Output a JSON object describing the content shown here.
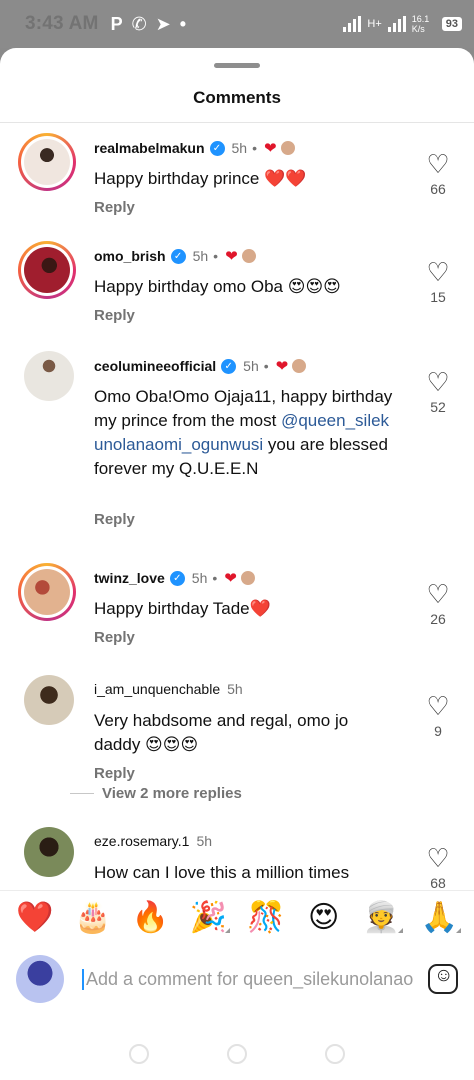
{
  "status_bar": {
    "time": "3:43 AM",
    "network_type": "H+",
    "speed": "16.1 K/s",
    "battery": "93"
  },
  "sheet": {
    "title": "Comments"
  },
  "comments": [
    {
      "username": "realmabelmakun",
      "verified": true,
      "time": "5h",
      "text": "Happy birthday prince ❤️❤️",
      "reply_label": "Reply",
      "likes": "66",
      "story_ring": true,
      "avatar_color": "#c9a58f"
    },
    {
      "username": "omo_brish",
      "verified": true,
      "time": "5h",
      "text": "Happy birthday omo Oba 😍😍😍",
      "reply_label": "Reply",
      "likes": "15",
      "story_ring": true,
      "avatar_color": "#a01e2e"
    },
    {
      "username": "ceolumineeofficial",
      "verified": true,
      "time": "5h",
      "text_before": "Omo Oba!Omo Ojaja11,  happy birthday my prince from the most ",
      "mention": "@queen_silekunolanaomi_ogunwusi",
      "text_after": "  you are blessed forever my Q.U.E.E.N",
      "reply_label": "Reply",
      "likes": "52",
      "story_ring": false,
      "avatar_color": "#d9d6cf"
    },
    {
      "username": "twinz_love",
      "verified": true,
      "time": "5h",
      "text": "Happy birthday Tade❤️",
      "reply_label": "Reply",
      "likes": "26",
      "story_ring": true,
      "avatar_color": "#e2b28f"
    },
    {
      "username": "i_am_unquenchable",
      "verified": false,
      "time": "5h",
      "text": "Very habdsome and regal, omo jo daddy 😍😍😍",
      "reply_label": "Reply",
      "likes": "9",
      "story_ring": false,
      "avatar_color": "#6e5a3c"
    },
    {
      "username": "eze.rosemary.1",
      "verified": false,
      "time": "5h",
      "text": "How can I love this a million times Happy Birthday Cute Prince",
      "likes": "68",
      "story_ring": false,
      "avatar_color": "#5a4632"
    }
  ],
  "view_more_replies": "View 2 more replies",
  "quick_emojis": [
    "❤️",
    "🎂",
    "🔥",
    "🎉",
    "🎊",
    "😍",
    "👳",
    "🙏"
  ],
  "comment_input": {
    "placeholder": "Add a comment for queen_silekunolanaomi_ogunwusi"
  }
}
